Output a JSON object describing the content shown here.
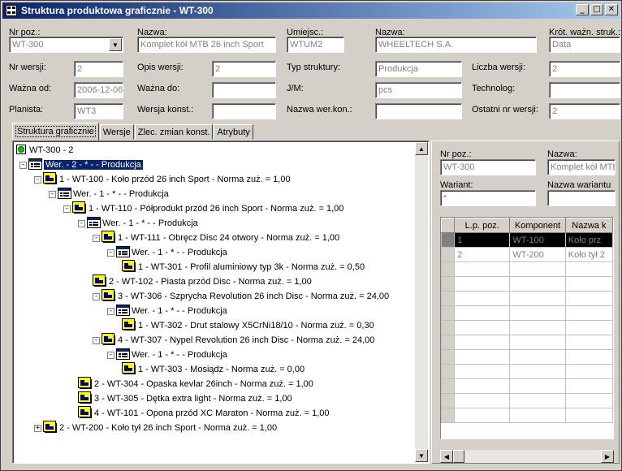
{
  "window": {
    "title": "Struktura produktowa graficznie - WT-300",
    "buttons": [
      "_",
      "□",
      "✕"
    ]
  },
  "header": {
    "nr_poz_label": "Nr poz.:",
    "nr_poz_value": "WT-300",
    "nazwa_label": "Nazwa:",
    "nazwa_value": "Komplet kół MTB 26 inch Sport",
    "umiejsc_label": "Umiejsc.:",
    "umiejsc_value": "WTUM2",
    "nazwa2_label": "Nazwa:",
    "nazwa2_value": "WHEELTECH S.A.",
    "krot_label": "Krót. ważn. struk.:",
    "krot_value": "Data",
    "nr_wersji_label": "Nr wersji:",
    "nr_wersji_value": "2",
    "opis_wersji_label": "Opis wersji:",
    "opis_wersji_value": "2",
    "typ_struktury_label": "Typ struktury:",
    "typ_struktury_value": "Produkcja",
    "liczba_wersji_label": "Liczba wersji:",
    "liczba_wersji_value": "2",
    "wazna_od_label": "Ważna od:",
    "wazna_od_value": "2006-12-06",
    "wazna_do_label": "Ważna do:",
    "wazna_do_value": "",
    "jm_label": "J/M:",
    "jm_value": "pcs",
    "technolog_label": "Technolog:",
    "technolog_value": "",
    "planista_label": "Planista:",
    "planista_value": "WT3",
    "wersja_konst_label": "Wersja konst.:",
    "wersja_konst_value": "",
    "nazwa_wer_kon_label": "Nazwa wer.kon.:",
    "nazwa_wer_kon_value": "",
    "ostatni_label": "Ostatni nr wersji:",
    "ostatni_value": "2"
  },
  "tabs": [
    "Struktura graficznie",
    "Wersje",
    "Zlec. zmian konst.",
    "Atrybuty"
  ],
  "tree": [
    {
      "text": "WT-300 - 2",
      "icon": "root-icon",
      "expander": ""
    },
    {
      "text": "Wer. - 2 - * -  - Produkcja",
      "icon": "version-icon",
      "expander": "-",
      "selected": true
    },
    {
      "text": "1 - WT-100 - Koło przód 26 inch Sport - Norma zuż. = 1,00",
      "icon": "item-icon",
      "expander": "-"
    },
    {
      "text": "Wer. - 1 - * -  - Produkcja",
      "icon": "version-icon",
      "expander": "-"
    },
    {
      "text": "1 - WT-110 - Półprodukt przód 26 inch Sport - Norma zuż. = 1,00",
      "icon": "item-icon",
      "expander": "-"
    },
    {
      "text": "Wer. - 1 - * -  - Produkcja",
      "icon": "version-icon",
      "expander": "-"
    },
    {
      "text": "1 - WT-111 - Obręcz Disc 24 otwory - Norma zuż. = 1,00",
      "icon": "item-icon",
      "expander": "-"
    },
    {
      "text": "Wer. - 1 - * -  - Produkcja",
      "icon": "version-icon",
      "expander": "-"
    },
    {
      "text": "1 - WT-301 - Profil aluminiowy typ 3k - Norma zuż. = 0,50",
      "icon": "item-icon",
      "expander": ""
    },
    {
      "text": "2 - WT-102 - Piasta przód Disc - Norma zuż. = 1,00",
      "icon": "item-icon",
      "expander": ""
    },
    {
      "text": "3 - WT-306 - Szprycha Revolution 26 inch Disc - Norma zuż. = 24,00",
      "icon": "item-icon",
      "expander": "-"
    },
    {
      "text": "Wer. - 1 - * -  - Produkcja",
      "icon": "version-icon",
      "expander": "-"
    },
    {
      "text": "1 - WT-302 - Drut stalowy X5CrNi18/10 - Norma zuż. = 0,30",
      "icon": "item-icon",
      "expander": ""
    },
    {
      "text": "4 - WT-307 - Nypel Revolution 26 inch Disc - Norma zuż. = 24,00",
      "icon": "item-icon",
      "expander": "-"
    },
    {
      "text": "Wer. - 1 - * -  - Produkcja",
      "icon": "version-icon",
      "expander": "-"
    },
    {
      "text": "1 - WT-303 - Mosiądz - Norma zuż. = 0,00",
      "icon": "item-icon",
      "expander": ""
    },
    {
      "text": "2 - WT-304 - Opaska kevlar 26inch - Norma zuż. = 1,00",
      "icon": "item-icon",
      "expander": ""
    },
    {
      "text": "3 - WT-305 - Dętka extra light - Norma zuż. = 1,00",
      "icon": "item-icon",
      "expander": ""
    },
    {
      "text": "4 - WT-101 - Opona przód XC Maraton - Norma zuż. = 1,00",
      "icon": "item-icon",
      "expander": ""
    },
    {
      "text": "2 - WT-200 - Koło tył 26 inch Sport - Norma zuż. = 1,00",
      "icon": "item-icon",
      "expander": "+"
    }
  ],
  "right": {
    "nr_poz_label": "Nr poz.:",
    "nr_poz_value": "WT-300",
    "nazwa_label": "Nazwa:",
    "nazwa_value": "Komplet kół MTB",
    "wariant_label": "Wariant:",
    "wariant_value": "*",
    "nazwa_wariantu_label": "Nazwa wariantu",
    "nazwa_wariantu_value": "",
    "grid_headers": [
      "",
      "L.p. poz.",
      "Komponent",
      "Nazwa k"
    ],
    "grid_rows": [
      {
        "lp": "1",
        "komponent": "WT-100",
        "nazwa": "Koło prz"
      },
      {
        "lp": "2",
        "komponent": "WT-200",
        "nazwa": "Koło tył 2"
      }
    ]
  }
}
